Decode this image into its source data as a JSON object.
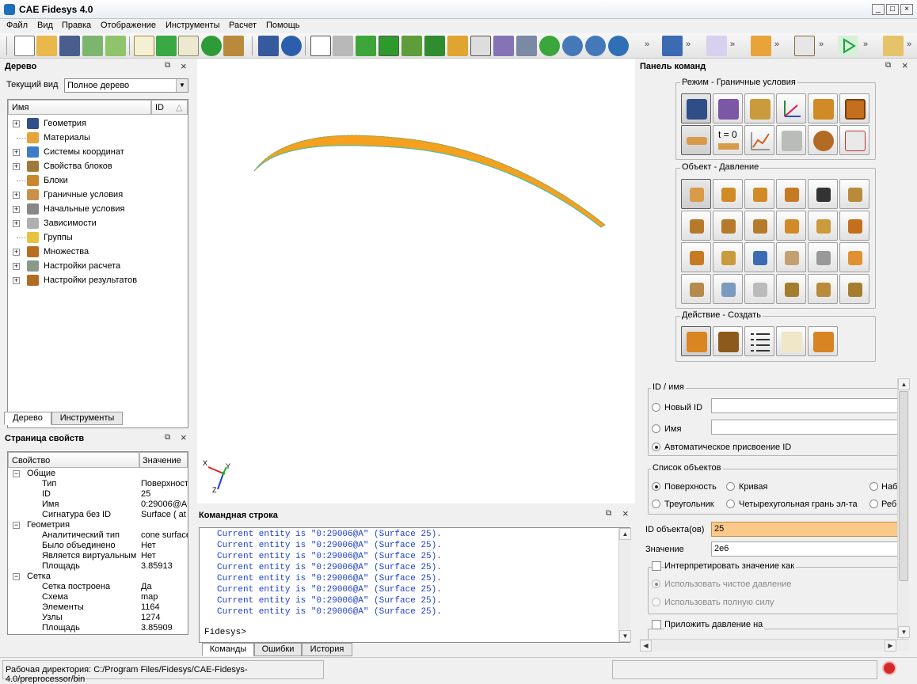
{
  "window": {
    "title": "CAE Fidesys 4.0",
    "btn_min": "_",
    "btn_max": "□",
    "btn_close": "×"
  },
  "menu": [
    "Файл",
    "Вид",
    "Правка",
    "Отображение",
    "Инструменты",
    "Расчет",
    "Помощь"
  ],
  "toolbar": {
    "more": "»"
  },
  "tree_panel": {
    "title": "Дерево",
    "view_label": "Текущий вид",
    "view_value": "Полное дерево",
    "col_name": "Имя",
    "col_id": "ID",
    "items": [
      {
        "label": "Геометрия",
        "icon": "geometry-icon",
        "expandable": true
      },
      {
        "label": "Материалы",
        "icon": "materials-icon",
        "expandable": false
      },
      {
        "label": "Системы координат",
        "icon": "coordinate-systems-icon",
        "expandable": true
      },
      {
        "label": "Свойства блоков",
        "icon": "block-properties-icon",
        "expandable": true
      },
      {
        "label": "Блоки",
        "icon": "blocks-icon",
        "expandable": false
      },
      {
        "label": "Граничные условия",
        "icon": "boundary-conditions-icon",
        "expandable": true
      },
      {
        "label": "Начальные условия",
        "icon": "initial-conditions-icon",
        "expandable": true
      },
      {
        "label": "Зависимости",
        "icon": "dependencies-icon",
        "expandable": true
      },
      {
        "label": "Группы",
        "icon": "groups-icon",
        "expandable": false
      },
      {
        "label": "Множества",
        "icon": "sets-icon",
        "expandable": true
      },
      {
        "label": "Настройки расчета",
        "icon": "calc-settings-icon",
        "expandable": true
      },
      {
        "label": "Настройки результатов",
        "icon": "results-settings-icon",
        "expandable": true
      }
    ],
    "tabs": [
      "Дерево",
      "Инструменты"
    ]
  },
  "properties_panel": {
    "title": "Страница свойств",
    "col_prop": "Свойство",
    "col_value": "Значение",
    "rows": [
      {
        "label": "Общие",
        "value": "",
        "level": 0
      },
      {
        "label": "Тип",
        "value": "Поверхност",
        "level": 1
      },
      {
        "label": "ID",
        "value": "25",
        "level": 1
      },
      {
        "label": "Имя",
        "value": "0:29006@A",
        "level": 1
      },
      {
        "label": "Сигнатура без ID",
        "value": "Surface ( at",
        "level": 1
      },
      {
        "label": "Геометрия",
        "value": "",
        "level": 0
      },
      {
        "label": "Аналитический тип",
        "value": "cone surface",
        "level": 1
      },
      {
        "label": "Было объединено",
        "value": "Нет",
        "level": 1
      },
      {
        "label": "Является виртуальным",
        "value": "Нет",
        "level": 1
      },
      {
        "label": "Площадь",
        "value": "3.85913",
        "level": 1
      },
      {
        "label": "Сетка",
        "value": "",
        "level": 0
      },
      {
        "label": "Сетка построена",
        "value": "Да",
        "level": 1
      },
      {
        "label": "Схема",
        "value": "map",
        "level": 1
      },
      {
        "label": "Элементы",
        "value": "1164",
        "level": 1
      },
      {
        "label": "Узлы",
        "value": "1274",
        "level": 1
      },
      {
        "label": "Площадь",
        "value": "3.85909",
        "level": 1
      }
    ]
  },
  "viewport": {
    "axis_x": "X",
    "axis_y": "Y",
    "axis_z": "Z",
    "shape_color": "#f5a01e",
    "edge_color": "#2fc7b9"
  },
  "console": {
    "title": "Командная строка",
    "lines": [
      "Current entity is \"0:29006@A\" (Surface 25).",
      "Current entity is \"0:29006@A\" (Surface 25).",
      "Current entity is \"0:29006@A\" (Surface 25).",
      "Current entity is \"0:29006@A\" (Surface 25).",
      "Current entity is \"0:29006@A\" (Surface 25).",
      "Current entity is \"0:29006@A\" (Surface 25).",
      "Current entity is \"0:29006@A\" (Surface 25).",
      "Current entity is \"0:29006@A\" (Surface 25)."
    ],
    "prompt": "Fidesys>",
    "tabs": [
      "Команды",
      "Ошибки",
      "История"
    ]
  },
  "command_panel": {
    "title": "Панель команд",
    "mode_group": "Режим - Граничные условия",
    "object_group": "Объект - Давление",
    "action_group": "Действие - Создать",
    "t0_label": "t = 0",
    "id_group": "ID / имя",
    "new_id": "Новый ID",
    "name": "Имя",
    "auto_id": "Автоматическое присвоение ID",
    "objects_group": "Список объектов",
    "obj_surface": "Поверхность",
    "obj_curve": "Кривая",
    "obj_trunc1": "Наб",
    "obj_triangle": "Треугольник",
    "obj_quadface": "Четырехугольная грань эл-та",
    "obj_trunc2": "Реб",
    "object_ids_label": "ID объекта(ов)",
    "object_ids_value": "25",
    "value_label": "Значение",
    "value_value": "2e6",
    "interpret_label": "Интерпретировать значение как",
    "use_pressure": "Использовать чистое давление",
    "use_force": "Использовать полную силу",
    "apply_label": "Приложить давление на"
  },
  "status": {
    "workdir": "Рабочая директория: C:/Program Files/Fidesys/CAE-Fidesys-4.0/preprocessor/bin"
  }
}
